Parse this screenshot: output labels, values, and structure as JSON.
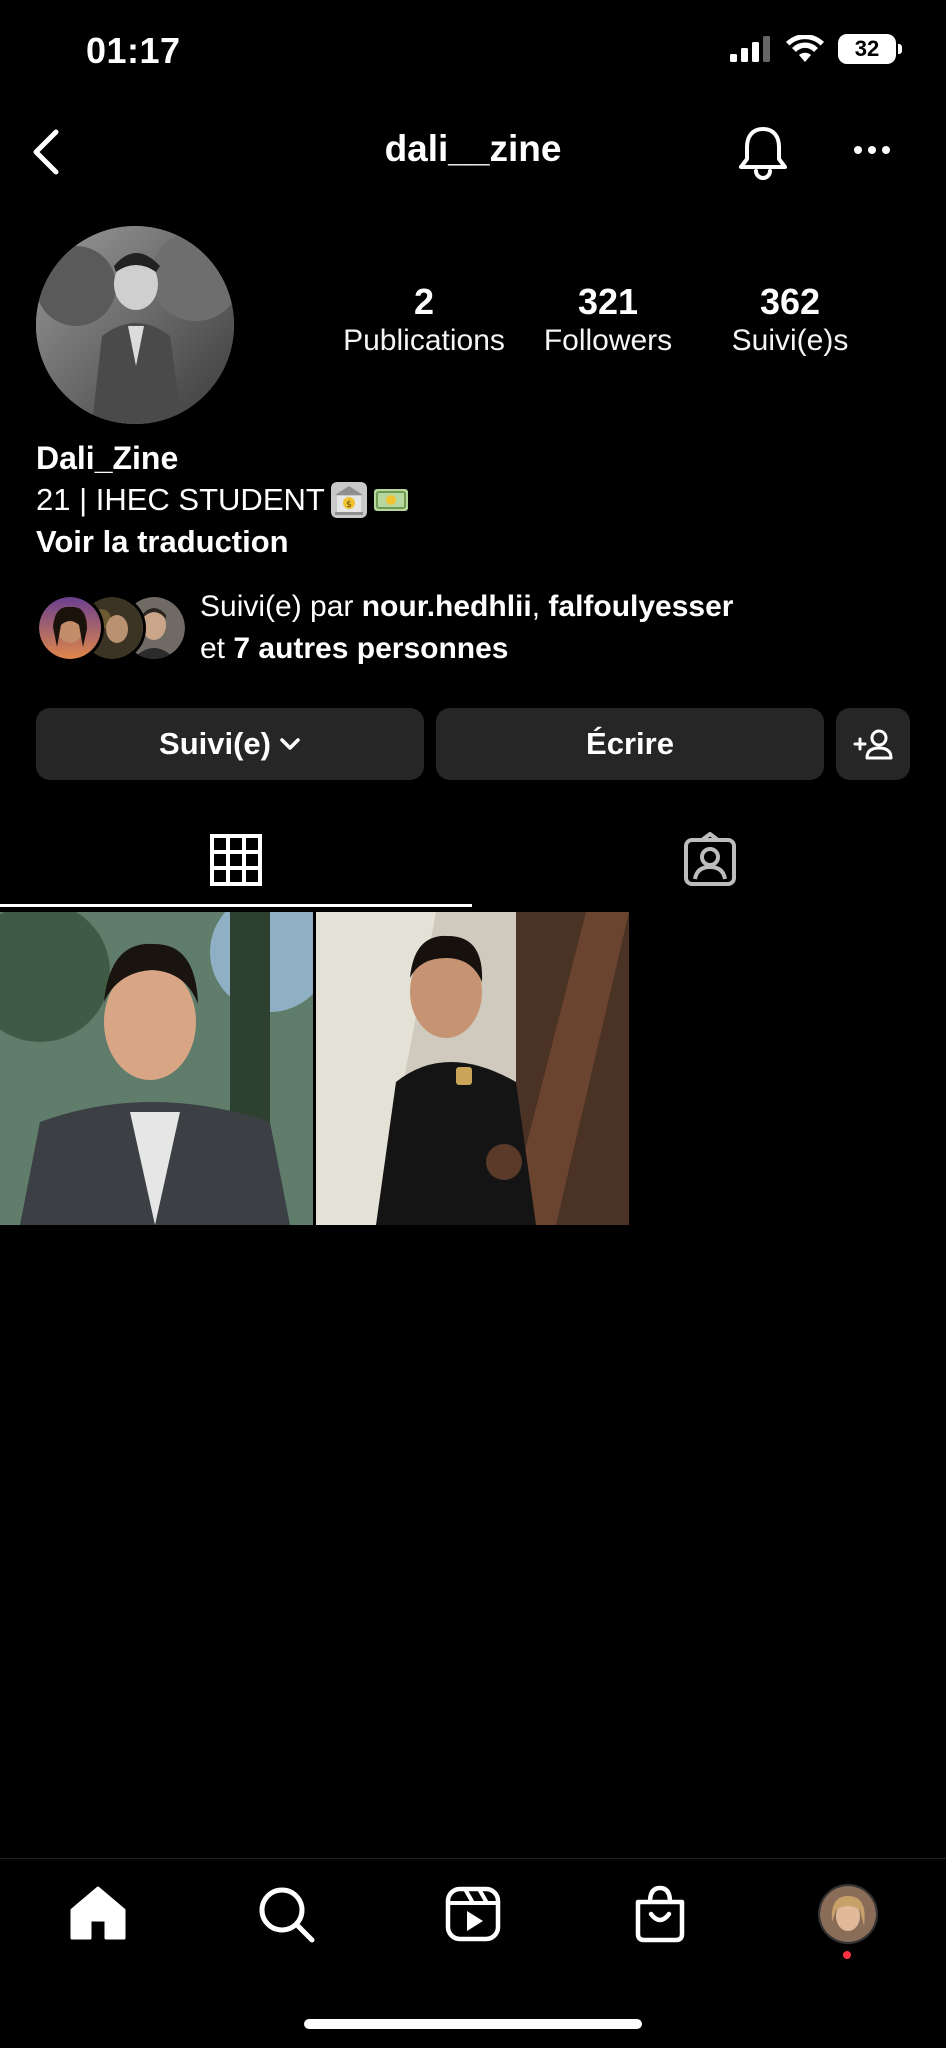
{
  "status_bar": {
    "time": "01:17",
    "battery": "32"
  },
  "header": {
    "username": "dali__zine"
  },
  "profile": {
    "stats": [
      {
        "value": "2",
        "label": "Publications"
      },
      {
        "value": "321",
        "label": "Followers"
      },
      {
        "value": "362",
        "label": "Suivi(e)s"
      }
    ],
    "display_name": "Dali_Zine",
    "bio": "21 | IHEC STUDENT",
    "bio_emojis": [
      "bank-icon",
      "money-icon"
    ],
    "translate_link": "Voir la traduction",
    "mutual": {
      "prefix": "Suivi(e) par ",
      "names": "nour.hedhlii",
      "sep": ", ",
      "names2": "falfoulyesser",
      "line2_prefix": "et ",
      "others": "7 autres personnes"
    }
  },
  "actions": {
    "following_label": "Suivi(e)",
    "message_label": "Écrire",
    "suggest_icon": "add-person-icon"
  },
  "tabs": [
    "grid-icon",
    "tagged-icon"
  ],
  "bottom_nav": [
    "home-icon",
    "search-icon",
    "reels-icon",
    "shop-icon",
    "profile-avatar"
  ],
  "colors": {
    "background": "#000000",
    "button": "#262626",
    "notification_dot": "#ff3040"
  }
}
